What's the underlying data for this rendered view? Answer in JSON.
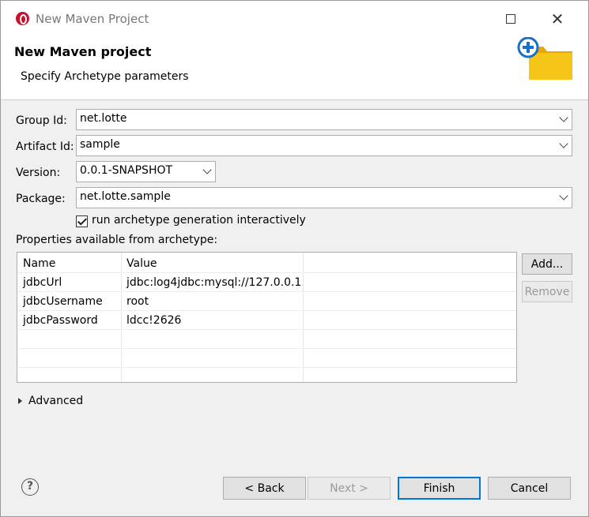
{
  "window": {
    "title": "New Maven Project"
  },
  "header": {
    "title": "New Maven project",
    "subtitle": "Specify Archetype parameters"
  },
  "form": {
    "group_id": {
      "label": "Group Id:",
      "value": "net.lotte"
    },
    "artifact_id": {
      "label": "Artifact Id:",
      "value": "sample"
    },
    "version": {
      "label": "Version:",
      "value": "0.0.1-SNAPSHOT"
    },
    "package": {
      "label": "Package:",
      "value": "net.lotte.sample"
    },
    "interactive": {
      "label": "run archetype generation interactively",
      "checked": true
    }
  },
  "properties": {
    "label": "Properties available from archetype:",
    "columns": [
      "Name",
      "Value"
    ],
    "rows": [
      {
        "name": "jdbcUrl",
        "value": "jdbc:log4jdbc:mysql://127.0.0.1..."
      },
      {
        "name": "jdbcUsername",
        "value": "root"
      },
      {
        "name": "jdbcPassword",
        "value": "ldcc!2626"
      }
    ],
    "add_label": "Add...",
    "remove_label": "Remove"
  },
  "advanced": {
    "label": "Advanced"
  },
  "footer": {
    "help_glyph": "?",
    "back_label": "< Back",
    "next_label": "Next >",
    "finish_label": "Finish",
    "cancel_label": "Cancel"
  },
  "colors": {
    "accent": "#0078d7",
    "app_icon": "#c8102e",
    "folder": "#f5c518",
    "plus": "#1c6fc6"
  }
}
